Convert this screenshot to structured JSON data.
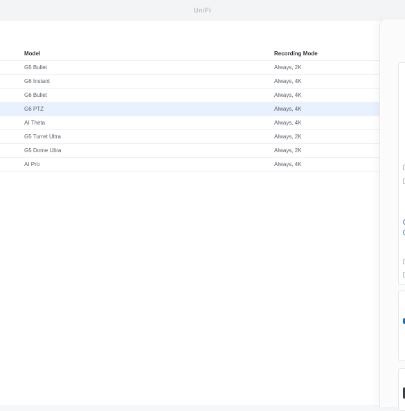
{
  "app": {
    "brand": "UniFi"
  },
  "table": {
    "headers": {
      "model": "Model",
      "recording_mode": "Recording Mode"
    },
    "rows": [
      {
        "model": "G5 Bullet",
        "mode": "Always, 2K"
      },
      {
        "model": "G6 Instant",
        "mode": "Always, 4K"
      },
      {
        "model": "G6 Bullet",
        "mode": "Always, 4K"
      },
      {
        "model": "G6 PTZ",
        "mode": "Always, 4K"
      },
      {
        "model": "AI Theta",
        "mode": "Always, 4K"
      },
      {
        "model": "G5 Turret Ultra",
        "mode": "Always, 2K"
      },
      {
        "model": "G5 Dome Ultra",
        "mode": "Always, 2K"
      },
      {
        "model": "AI Pro",
        "mode": "Always, 4K"
      }
    ],
    "selected_row": 3
  },
  "colors": {
    "accent": "#2f7de1",
    "selection": "#e8f1fe"
  }
}
